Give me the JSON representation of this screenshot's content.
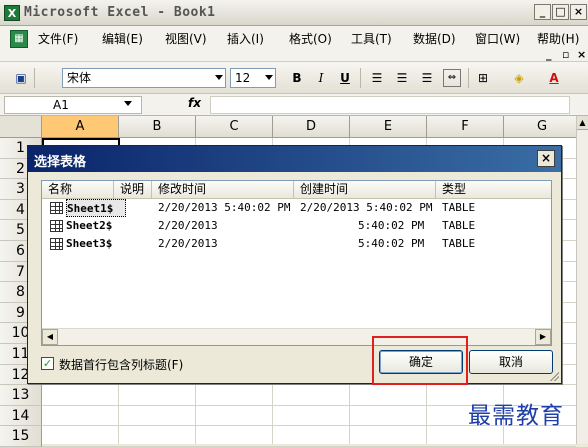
{
  "window": {
    "title": "Microsoft Excel - Book1"
  },
  "menu": {
    "items": [
      "文件(F)",
      "编辑(E)",
      "视图(V)",
      "插入(I)",
      "格式(O)",
      "工具(T)",
      "数据(D)",
      "窗口(W)",
      "帮助(H)"
    ]
  },
  "toolbar": {
    "font_name": "宋体",
    "font_size": "12",
    "bold": "B",
    "italic": "I",
    "underline": "U"
  },
  "formula_bar": {
    "name_box": "A1",
    "fx": "fx"
  },
  "grid": {
    "columns": [
      "A",
      "B",
      "C",
      "D",
      "E",
      "F",
      "G"
    ],
    "rows": [
      "1",
      "2",
      "3",
      "4",
      "5",
      "6",
      "7",
      "8",
      "9",
      "10",
      "11",
      "12",
      "13",
      "14",
      "15"
    ]
  },
  "dialog": {
    "title": "选择表格",
    "close": "×",
    "columns": [
      "名称",
      "说明",
      "修改时间",
      "创建时间",
      "类型"
    ],
    "rows": [
      {
        "name": "Sheet1$",
        "desc": "",
        "modified": "2/20/2013 5:40:02 PM",
        "created": "2/20/2013 5:40:02 PM",
        "type": "TABLE"
      },
      {
        "name": "Sheet2$",
        "desc": "",
        "modified": "2/20/2013",
        "created": "5:40:02 PM",
        "type": "TABLE"
      },
      {
        "name": "Sheet3$",
        "desc": "",
        "modified": "2/20/2013",
        "created": "5:40:02 PM",
        "type": "TABLE"
      }
    ],
    "checkbox_label": "数据首行包含列标题(F)",
    "checkbox_checked": true,
    "ok_label": "确定",
    "cancel_label": "取消"
  },
  "watermark": "最需教育",
  "colors": {
    "dialog_title": "#0a246a",
    "highlight": "#e02020",
    "watermark": "#1e3ea8"
  }
}
